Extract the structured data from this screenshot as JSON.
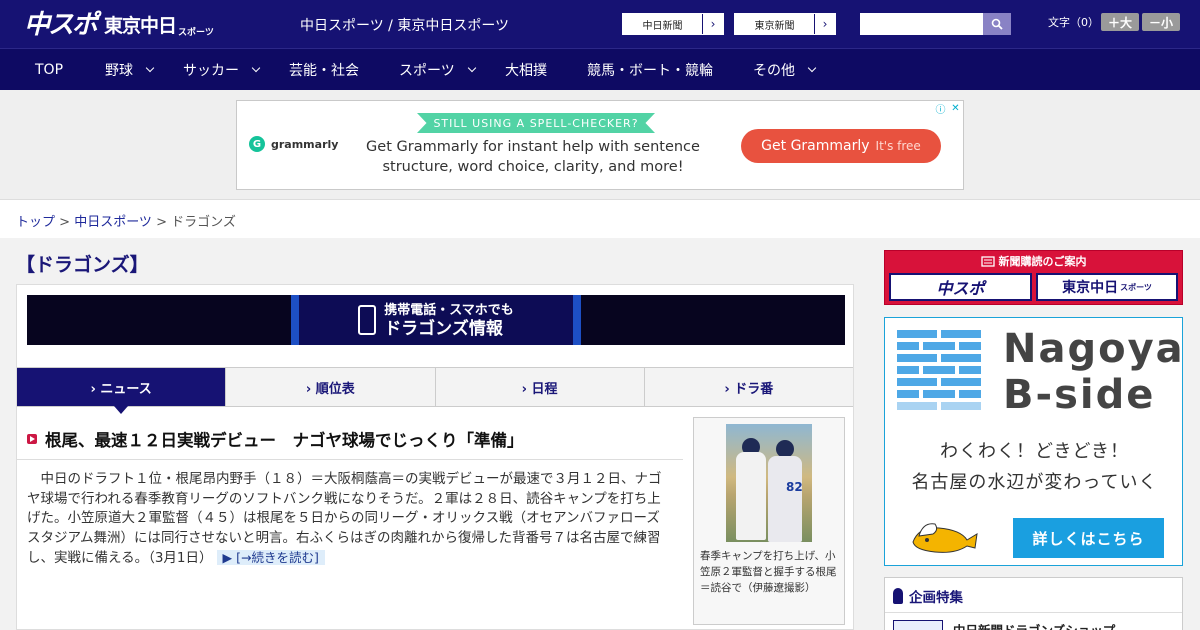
{
  "header": {
    "logo_main": "中スポ",
    "logo_tokyo": "東京中日",
    "logo_sports": "スポーツ",
    "site_name": "中日スポーツ / 東京中日スポーツ",
    "paper_links": [
      {
        "label": "中日新聞",
        "arrow": "›"
      },
      {
        "label": "東京新聞",
        "arrow": "›"
      }
    ],
    "search_value": "",
    "font_size_label": "文字（0）",
    "font_bigger": "＋大",
    "font_smaller": "－小"
  },
  "nav": {
    "items": [
      {
        "label": "TOP",
        "dropdown": false
      },
      {
        "label": "野球",
        "dropdown": true
      },
      {
        "label": "サッカー",
        "dropdown": true
      },
      {
        "label": "芸能・社会",
        "dropdown": false
      },
      {
        "label": "スポーツ",
        "dropdown": true
      },
      {
        "label": "大相撲",
        "dropdown": false
      },
      {
        "label": "競馬・ボート・競輪",
        "dropdown": false
      },
      {
        "label": "その他",
        "dropdown": true
      }
    ]
  },
  "ad": {
    "brand": "grammarly",
    "brand_icon": "G",
    "ribbon": "STILL USING A SPELL-CHECKER?",
    "body": "Get Grammarly for instant help with sentence structure, word choice, clarity, and more!",
    "cta_main": "Get Grammarly",
    "cta_sub": "It's free",
    "info_icon": "ⓘ",
    "close_icon": "✕"
  },
  "breadcrumb": {
    "top": "トップ",
    "sep": " > ",
    "section": "中日スポーツ",
    "current": "ドラゴンズ"
  },
  "page": {
    "title": "【ドラゴンズ】"
  },
  "promo": {
    "line1": "携帯電話・スマホでも",
    "line2": "ドラゴンズ情報"
  },
  "tabs": [
    {
      "label": "› ニュース",
      "active": true
    },
    {
      "label": "› 順位表",
      "active": false
    },
    {
      "label": "› 日程",
      "active": false
    },
    {
      "label": "› ドラ番",
      "active": false
    }
  ],
  "article": {
    "headline": "根尾、最速１２日実戦デビュー　ナゴヤ球場でじっくり「準備」",
    "body": "　中日のドラフト１位・根尾昂内野手（１８）＝大阪桐蔭高＝の実戦デビューが最速で３月１２日、ナゴヤ球場で行われる春季教育リーグのソフトバンク戦になりそうだ。２軍は２８日、読谷キャンプを打ち上げた。小笠原道大２軍監督（４５）は根尾を５日からの同リーグ・オリックス戦（オセアンバファローズスタジアム舞洲）には同行させないと明言。右ふくらはぎの肉離れから復帰した背番号７は名古屋で練習し、実戦に備える。（3月1日）",
    "read_more": "▶ [→続きを読む]",
    "photo_number": "82",
    "caption": "春季キャンプを打ち上げ、小笠原２軍監督と握手する根尾＝読谷で（伊藤遼撮影）"
  },
  "sidebar": {
    "subscribe_title": "新聞購読のご案内",
    "sub_logo_1": "中スポ",
    "sub_logo_2": "東京中日",
    "sub_logo_2_small": "スポーツ",
    "nb_title_line1": "Nagoya",
    "nb_title_line2": "B-side",
    "nb_copy_line1": "わくわく！どきどき！",
    "nb_copy_line2": "名古屋の水辺が変わっていく",
    "nb_button": "詳しくはこちら",
    "feature_title": "企画特集",
    "feature_item": "中日新聞ドラゴンズショップ"
  },
  "colors": {
    "header_bg": "#161273",
    "nav_bg": "#0e0a63",
    "accent_red": "#d8123a",
    "accent_blue": "#1a9fe0"
  }
}
